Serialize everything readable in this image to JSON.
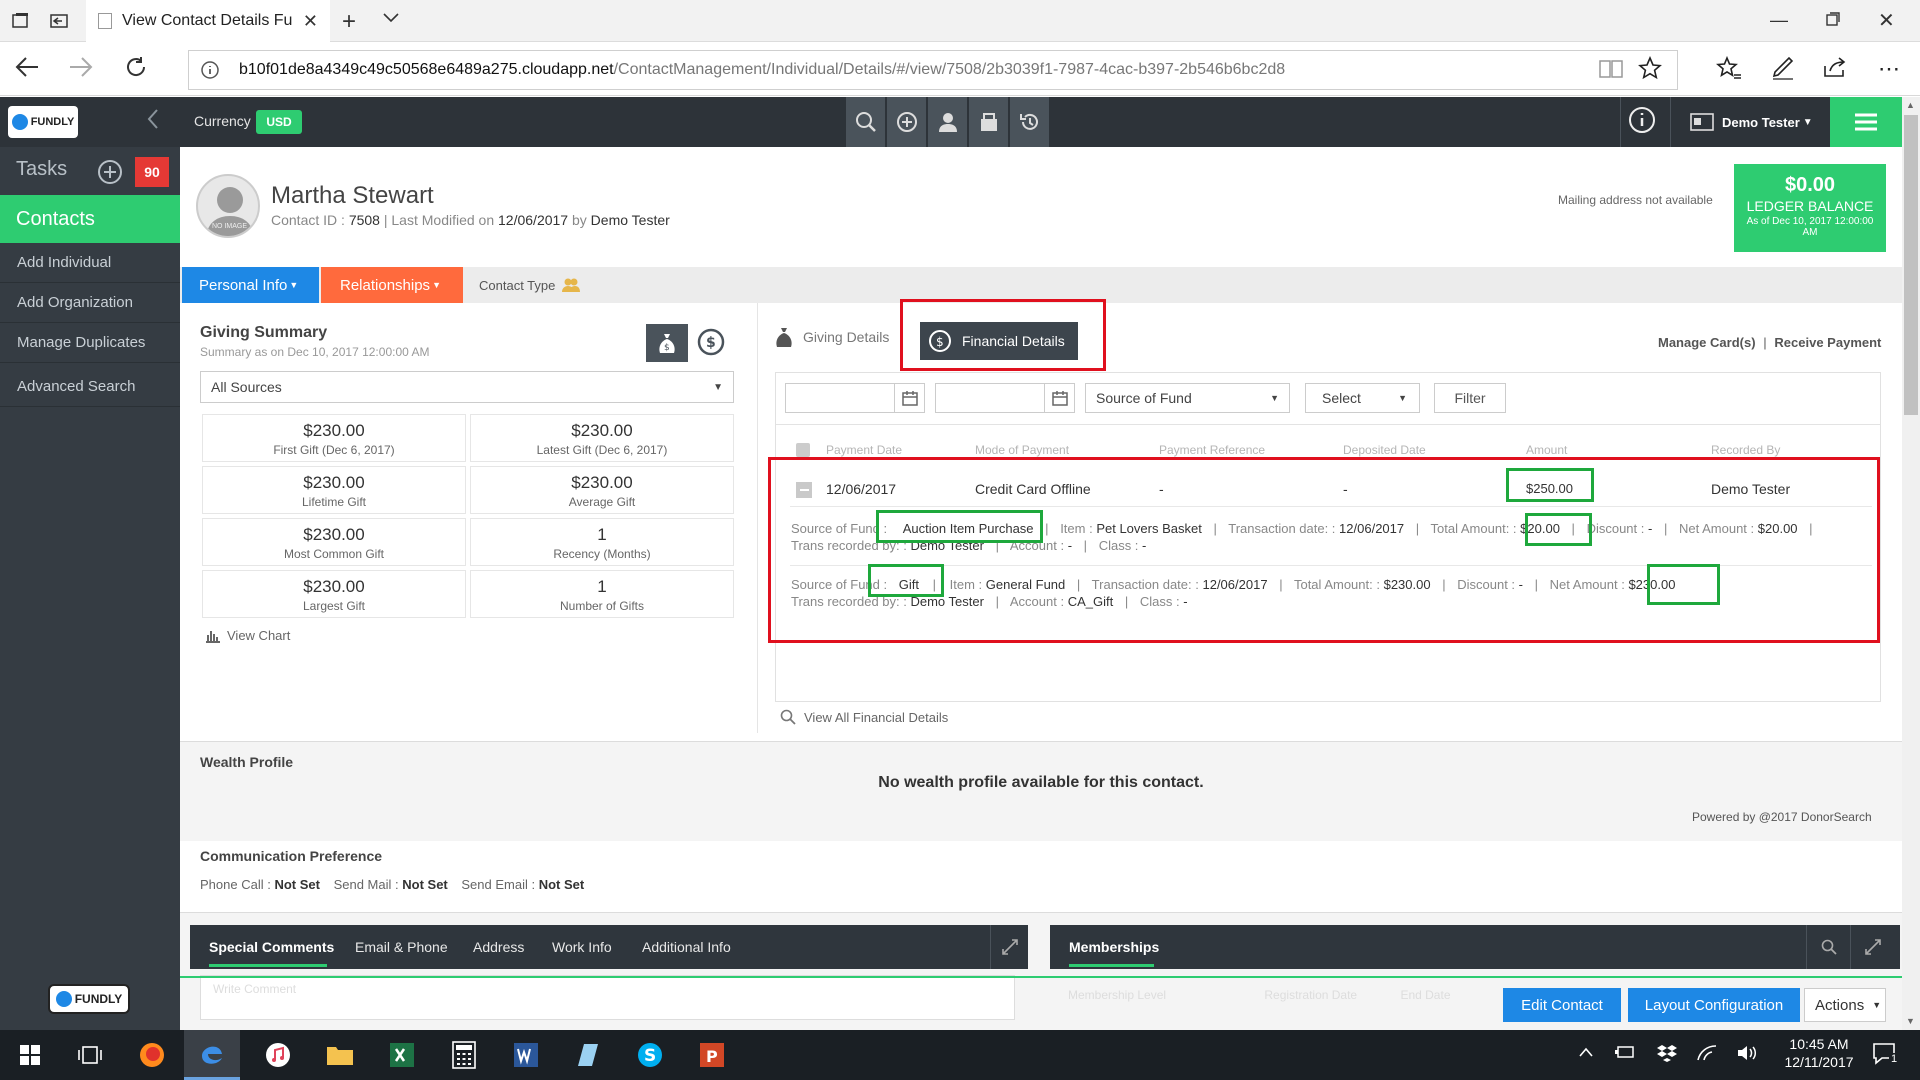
{
  "browser": {
    "tab_title": "View Contact Details Fu",
    "url_host": "b10f01de8a4349c49c50568e6489a275.cloudapp.net",
    "url_path": "/ContactManagement/Individual/Details/#/view/7508/2b3039f1-7987-4cac-b397-2b546b6bc2d8"
  },
  "header": {
    "logo": "FUNDLY",
    "currency_label": "Currency",
    "currency_value": "USD",
    "user": "Demo Tester"
  },
  "sidebar": {
    "tasks_label": "Tasks",
    "tasks_count": "90",
    "contacts_label": "Contacts",
    "items": [
      {
        "label": "Add Individual"
      },
      {
        "label": "Add Organization"
      },
      {
        "label": "Manage Duplicates"
      },
      {
        "label": "Advanced Search"
      }
    ],
    "footer_logo": "FUNDLY"
  },
  "contact": {
    "name": "Martha Stewart",
    "avatar_text": "NO IMAGE",
    "id_label": "Contact ID :",
    "id": "7508",
    "modified_label": "Last Modified on",
    "modified_date": "12/06/2017",
    "by_label": "by",
    "by": "Demo Tester",
    "mailing": "Mailing address not available"
  },
  "ledger": {
    "amount": "$0.00",
    "label": "LEDGER BALANCE",
    "asof": "As of Dec 10, 2017 12:00:00 AM"
  },
  "tabs": {
    "personal": "Personal Info",
    "relationships": "Relationships",
    "contact_type": "Contact Type"
  },
  "giving_summary": {
    "title": "Giving Summary",
    "subtitle": "Summary as on Dec 10, 2017 12:00:00 AM",
    "source_select": "All Sources",
    "cells": [
      {
        "value": "$230.00",
        "label": "First Gift (Dec 6, 2017)"
      },
      {
        "value": "$230.00",
        "label": "Latest Gift (Dec 6, 2017)"
      },
      {
        "value": "$230.00",
        "label": "Lifetime Gift"
      },
      {
        "value": "$230.00",
        "label": "Average Gift"
      },
      {
        "value": "$230.00",
        "label": "Most Common Gift"
      },
      {
        "value": "1",
        "label": "Recency (Months)"
      },
      {
        "value": "$230.00",
        "label": "Largest Gift"
      },
      {
        "value": "1",
        "label": "Number of Gifts"
      }
    ],
    "view_chart": "View Chart"
  },
  "financial": {
    "giving_details_tab": "Giving Details",
    "financial_details_tab": "Financial Details",
    "manage_cards": "Manage Card(s)",
    "receive_payment": "Receive Payment",
    "filter_source": "Source of Fund",
    "filter_select": "Select",
    "filter_button": "Filter",
    "columns": [
      "Payment Date",
      "Mode of Payment",
      "Payment Reference",
      "Deposited Date",
      "Amount",
      "Recorded By"
    ],
    "row": {
      "date": "12/06/2017",
      "mode": "Credit Card Offline",
      "reference": "-",
      "deposited": "-",
      "amount": "$250.00",
      "recorded_by": "Demo Tester"
    },
    "lines": [
      {
        "source_label": "Source of Fund :",
        "source": "Auction Item Purchase",
        "item_label": "Item :",
        "item": "Pet Lovers Basket",
        "txn_label": "Transaction date: :",
        "txn": "12/06/2017",
        "total_label": "Total Amount: :",
        "total": "$20.00",
        "discount_label": "Discount :",
        "discount": "-",
        "net_label": "Net Amount :",
        "net": "$20.00",
        "recorded_label": "Trans recorded by: :",
        "recorded": "Demo Tester",
        "account_label": "Account :",
        "account": "-",
        "class_label": "Class :",
        "class": "-"
      },
      {
        "source_label": "Source of Fund :",
        "source": "Gift",
        "item_label": "Item :",
        "item": "General Fund",
        "txn_label": "Transaction date: :",
        "txn": "12/06/2017",
        "total_label": "Total Amount: :",
        "total": "$230.00",
        "discount_label": "Discount :",
        "discount": "-",
        "net_label": "Net Amount :",
        "net": "$230.00",
        "recorded_label": "Trans recorded by: :",
        "recorded": "Demo Tester",
        "account_label": "Account :",
        "account": "CA_Gift",
        "class_label": "Class :",
        "class": "-"
      }
    ],
    "view_all": "View All Financial Details"
  },
  "wealth": {
    "title": "Wealth Profile",
    "message": "No wealth profile available for this contact.",
    "powered": "Powered by @2017 DonorSearch"
  },
  "communication": {
    "title": "Communication Preference",
    "phone_label": "Phone Call :",
    "phone": "Not Set",
    "mail_label": "Send Mail :",
    "mail": "Not Set",
    "email_label": "Send Email :",
    "email": "Not Set"
  },
  "bottom_tabs": {
    "left": [
      "Special Comments",
      "Email & Phone",
      "Address",
      "Work Info",
      "Additional Info"
    ],
    "right": "Memberships",
    "comment_placeholder": "Write Comment",
    "membership_cols": [
      "Membership Level",
      "Registration Date",
      "End Date"
    ]
  },
  "actions": {
    "edit": "Edit Contact",
    "layout": "Layout Configuration",
    "actions": "Actions"
  },
  "taskbar": {
    "time": "10:45 AM",
    "date": "12/11/2017",
    "notif": "1"
  },
  "colors": {
    "green": "#2ecc71",
    "blue": "#1e88e5",
    "orange": "#ff6a3d",
    "dark": "#2d3339",
    "red_highlight": "#e0101e",
    "green_highlight": "#1ea83c"
  }
}
